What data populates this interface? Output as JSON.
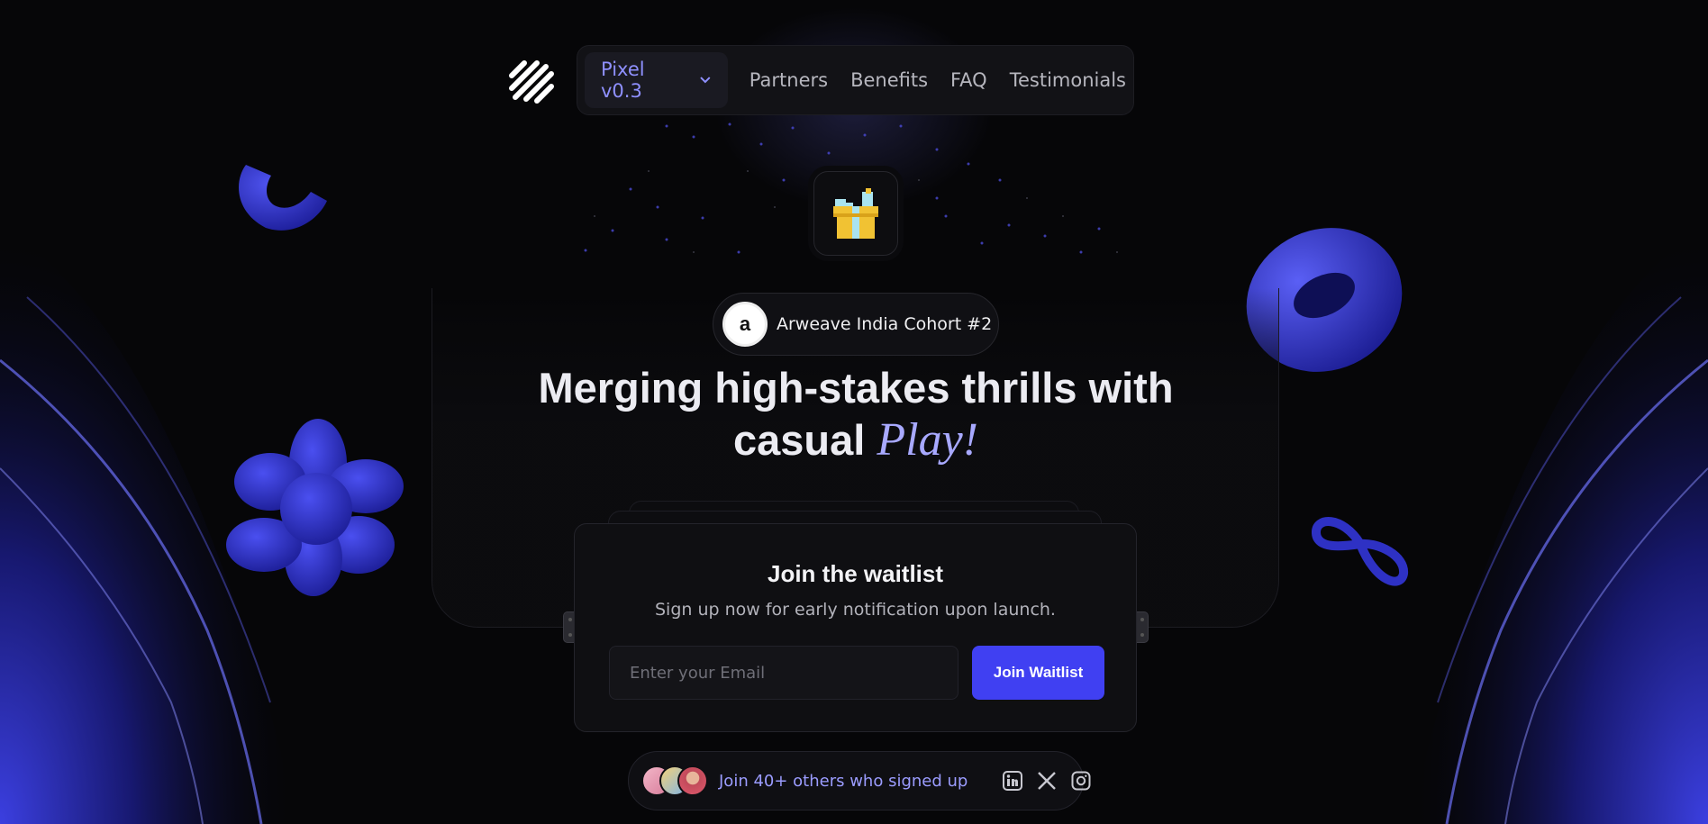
{
  "nav": {
    "version_label": "Pixel v0.3",
    "links": [
      "Partners",
      "Benefits",
      "FAQ",
      "Testimonials"
    ]
  },
  "badge": {
    "avatar_letter": "a",
    "text": "Arweave India Cohort #2"
  },
  "hero": {
    "headline_line1": "Merging high-stakes thrills with",
    "headline_line2_plain": "casual",
    "headline_line2_accent": "Play!"
  },
  "waitlist": {
    "title": "Join the waitlist",
    "subtitle": "Sign up now for early notification upon launch.",
    "email_placeholder": "Enter your Email",
    "email_value": "",
    "button_label": "Join Waitlist"
  },
  "social_proof": {
    "text": "Join 40+ others who signed up",
    "icons": [
      "linkedin-icon",
      "x-icon",
      "instagram-icon"
    ]
  },
  "colors": {
    "accent": "#4040f2",
    "accent_text": "#9b9cff",
    "background": "#060608",
    "blob": "#2a2ad0"
  }
}
